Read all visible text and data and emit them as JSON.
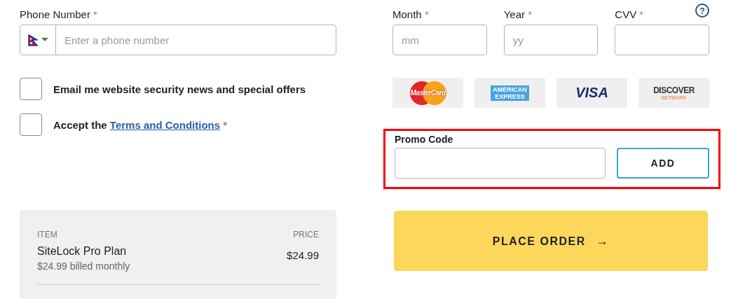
{
  "phone": {
    "label": "Phone Number",
    "required_mark": "*",
    "placeholder": "Enter a phone number"
  },
  "checkboxes": [
    {
      "kind": "plain",
      "text": "Email me website security news and special offers",
      "checked": false
    },
    {
      "kind": "terms",
      "prefix": "Accept the",
      "link": "Terms and Conditions",
      "required_mark": "*",
      "checked": false
    }
  ],
  "card_fields": [
    {
      "label": "Month",
      "required_mark": "*",
      "placeholder": "mm"
    },
    {
      "label": "Year",
      "required_mark": "*",
      "placeholder": "yy"
    },
    {
      "label": "CVV",
      "required_mark": "*",
      "help": "?"
    }
  ],
  "card_logos": [
    {
      "kind": "mastercard",
      "lines": [
        "MasterCard"
      ]
    },
    {
      "kind": "amex",
      "lines": [
        "AMERICAN",
        "EXPRESS"
      ]
    },
    {
      "kind": "visa",
      "lines": [
        "VISA"
      ]
    },
    {
      "kind": "discover",
      "lines": [
        "DISCOVER",
        "NETWORK"
      ]
    }
  ],
  "promo": {
    "label": "Promo Code",
    "button": "ADD",
    "highlighted": true
  },
  "order_summary": {
    "item_header": "ITEM",
    "price_header": "PRICE",
    "items": [
      {
        "name": "SiteLock Pro Plan",
        "billing": "$24.99 billed monthly",
        "price": "$24.99"
      }
    ]
  },
  "place_order": {
    "label": "PLACE ORDER",
    "arrow": "→"
  }
}
